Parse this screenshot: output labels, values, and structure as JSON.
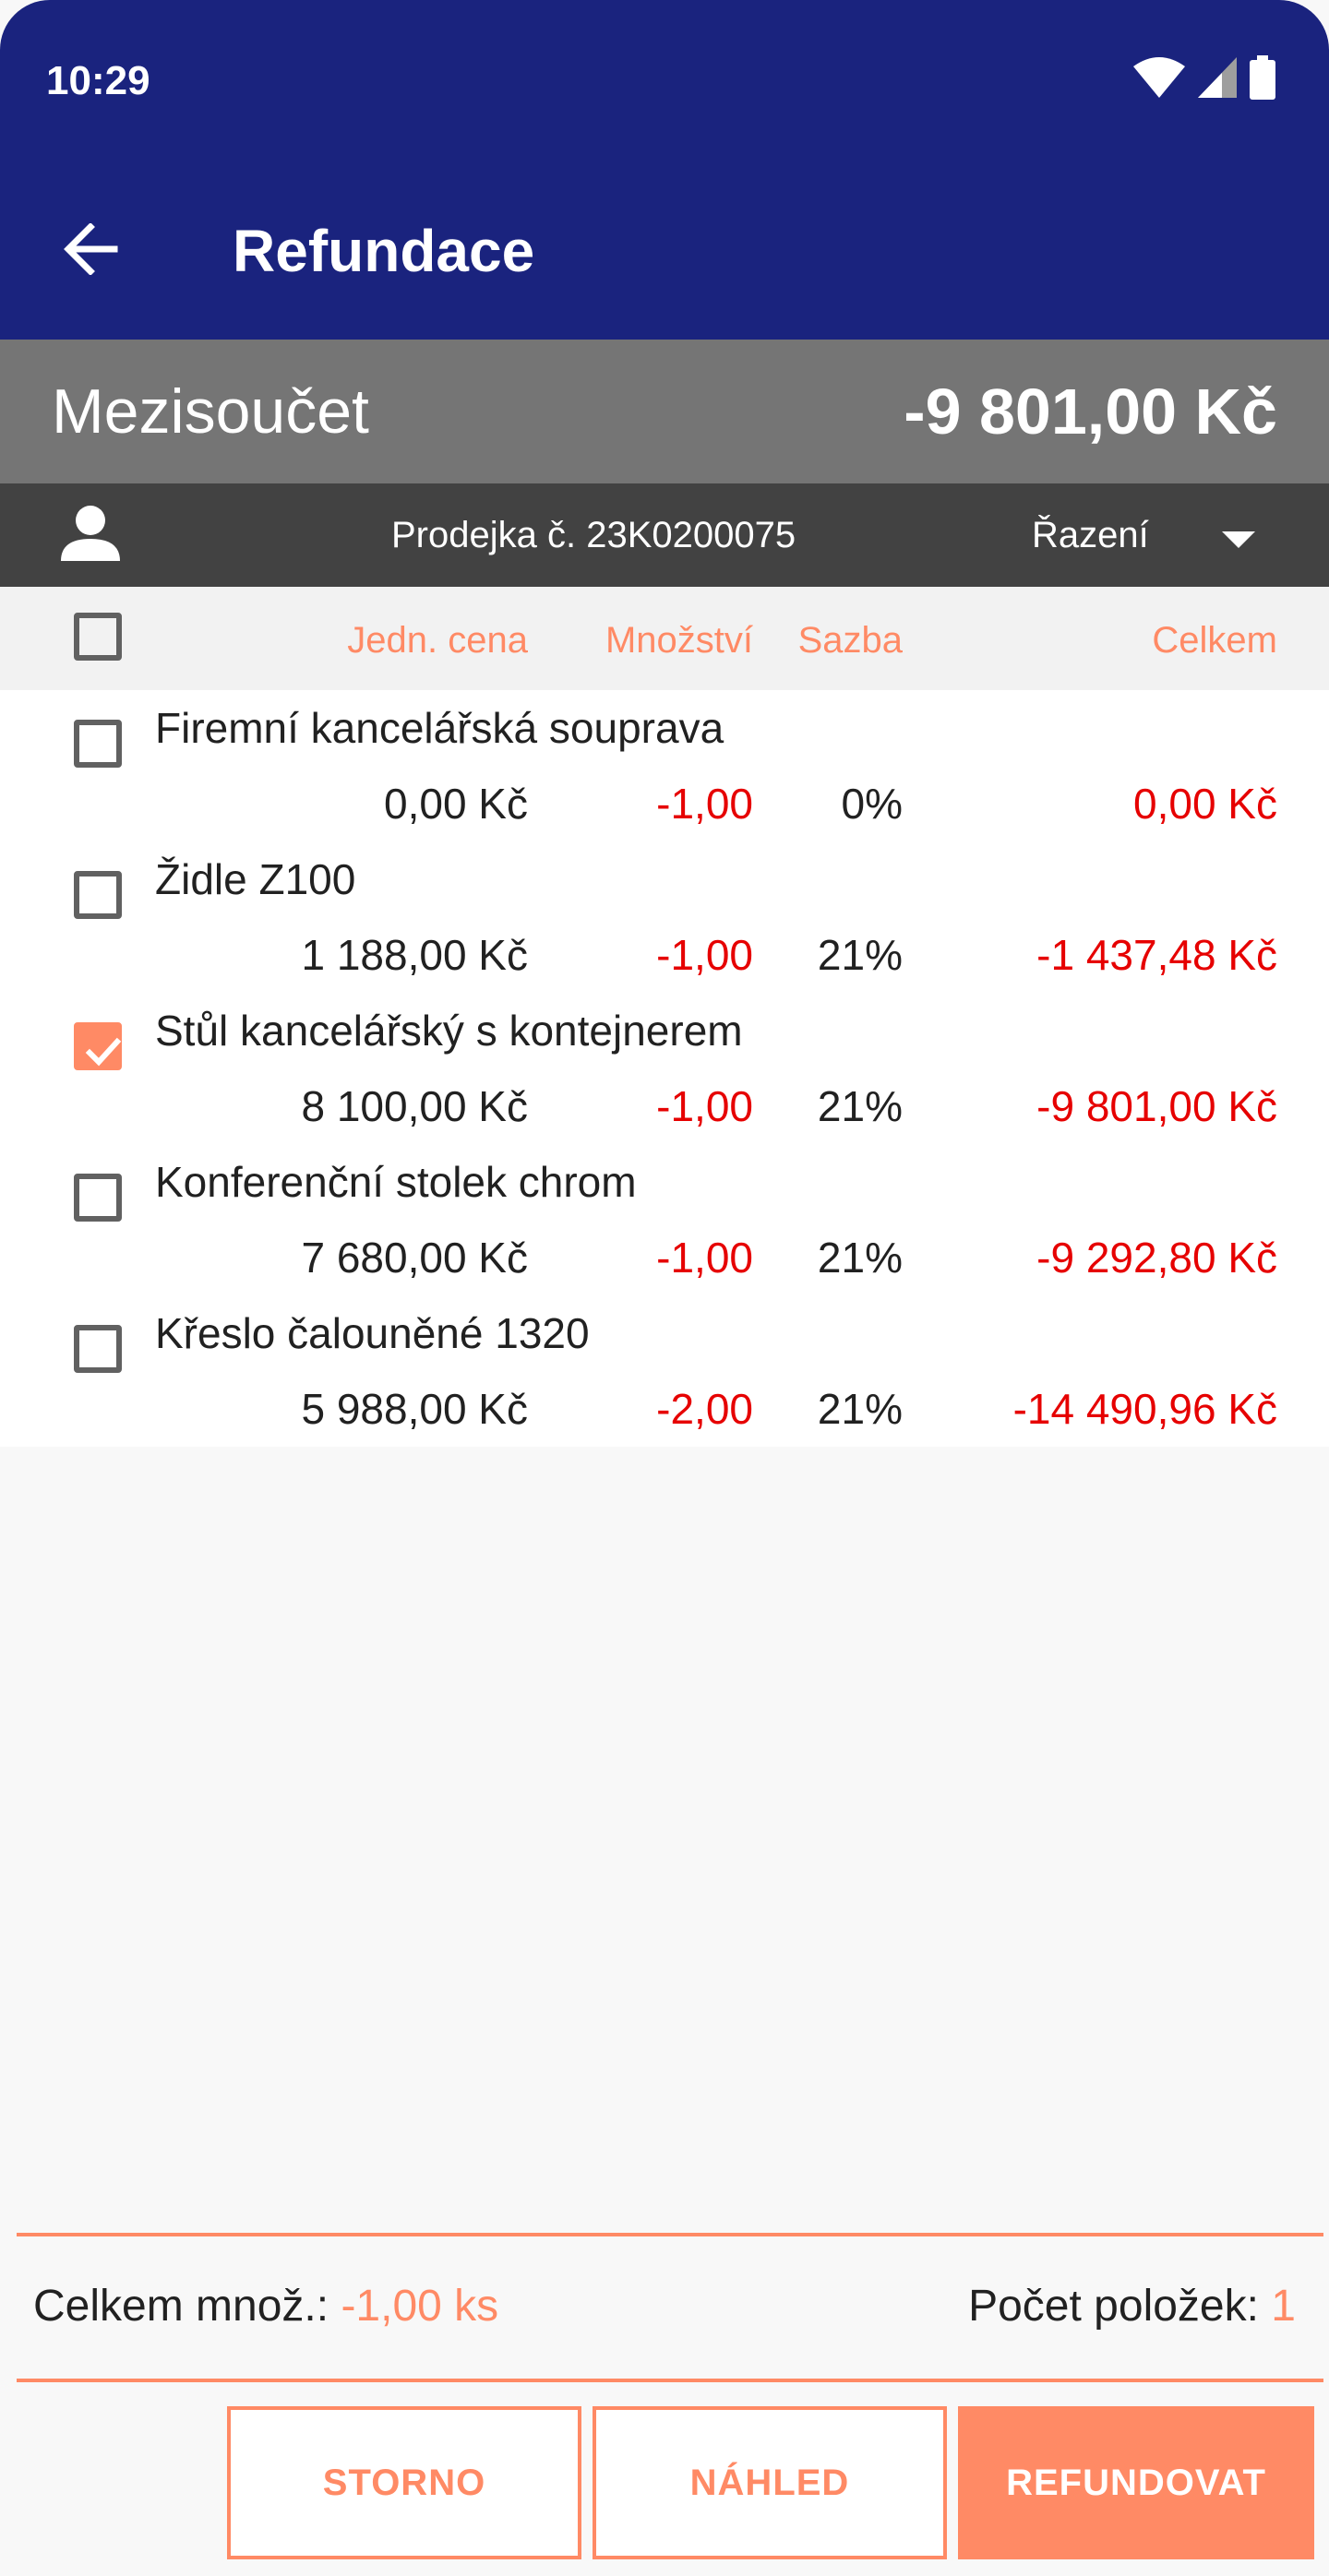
{
  "status_bar": {
    "time": "10:29"
  },
  "header": {
    "title": "Refundace"
  },
  "subtotal": {
    "label": "Mezisoučet",
    "value": "-9 801,00 Kč"
  },
  "info_bar": {
    "receipt": "Prodejka č. 23K0200075",
    "sort_label": "Řazení"
  },
  "table": {
    "columns": {
      "unit_price": "Jedn. cena",
      "quantity": "Množství",
      "rate": "Sazba",
      "total": "Celkem"
    },
    "rows": [
      {
        "name": "Firemní kancelářská souprava",
        "price": "0,00 Kč",
        "qty": "-1,00",
        "rate": "0%",
        "total": "0,00 Kč",
        "checked": false
      },
      {
        "name": "Židle Z100",
        "price": "1 188,00 Kč",
        "qty": "-1,00",
        "rate": "21%",
        "total": "-1 437,48 Kč",
        "checked": false
      },
      {
        "name": "Stůl kancelářský s kontejnerem",
        "price": "8 100,00 Kč",
        "qty": "-1,00",
        "rate": "21%",
        "total": "-9 801,00 Kč",
        "checked": true
      },
      {
        "name": "Konferenční stolek chrom",
        "price": "7 680,00 Kč",
        "qty": "-1,00",
        "rate": "21%",
        "total": "-9 292,80 Kč",
        "checked": false
      },
      {
        "name": "Křeslo čalouněné 1320",
        "price": "5 988,00 Kč",
        "qty": "-2,00",
        "rate": "21%",
        "total": "-14 490,96 Kč",
        "checked": false
      }
    ]
  },
  "footer": {
    "total_qty_label": "Celkem množ.:",
    "total_qty_value": "-1,00 ks",
    "item_count_label": "Počet položek:",
    "item_count_value": "1"
  },
  "buttons": {
    "cancel": "STORNO",
    "preview": "NÁHLED",
    "refund": "REFUNDOVAT"
  },
  "colors": {
    "appbar": "#1a237e",
    "accent": "#ff8a65",
    "negative": "#e60000"
  },
  "icons": [
    "back-arrow-icon",
    "wifi-icon",
    "signal-icon",
    "battery-icon",
    "person-icon",
    "dropdown-arrow-icon",
    "checkmark-icon"
  ]
}
